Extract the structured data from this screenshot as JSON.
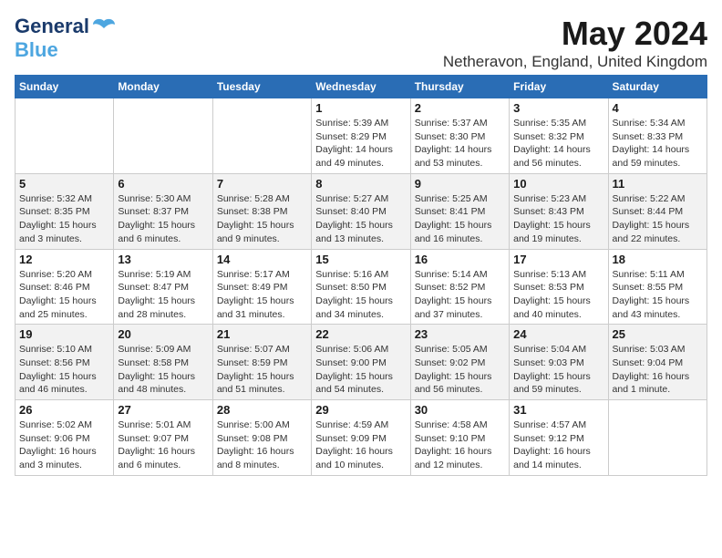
{
  "header": {
    "logo_line1": "General",
    "logo_line2": "Blue",
    "title": "May 2024",
    "subtitle": "Netheravon, England, United Kingdom"
  },
  "weekdays": [
    "Sunday",
    "Monday",
    "Tuesday",
    "Wednesday",
    "Thursday",
    "Friday",
    "Saturday"
  ],
  "weeks": [
    [
      {
        "day": "",
        "info": ""
      },
      {
        "day": "",
        "info": ""
      },
      {
        "day": "",
        "info": ""
      },
      {
        "day": "1",
        "info": "Sunrise: 5:39 AM\nSunset: 8:29 PM\nDaylight: 14 hours\nand 49 minutes."
      },
      {
        "day": "2",
        "info": "Sunrise: 5:37 AM\nSunset: 8:30 PM\nDaylight: 14 hours\nand 53 minutes."
      },
      {
        "day": "3",
        "info": "Sunrise: 5:35 AM\nSunset: 8:32 PM\nDaylight: 14 hours\nand 56 minutes."
      },
      {
        "day": "4",
        "info": "Sunrise: 5:34 AM\nSunset: 8:33 PM\nDaylight: 14 hours\nand 59 minutes."
      }
    ],
    [
      {
        "day": "5",
        "info": "Sunrise: 5:32 AM\nSunset: 8:35 PM\nDaylight: 15 hours\nand 3 minutes."
      },
      {
        "day": "6",
        "info": "Sunrise: 5:30 AM\nSunset: 8:37 PM\nDaylight: 15 hours\nand 6 minutes."
      },
      {
        "day": "7",
        "info": "Sunrise: 5:28 AM\nSunset: 8:38 PM\nDaylight: 15 hours\nand 9 minutes."
      },
      {
        "day": "8",
        "info": "Sunrise: 5:27 AM\nSunset: 8:40 PM\nDaylight: 15 hours\nand 13 minutes."
      },
      {
        "day": "9",
        "info": "Sunrise: 5:25 AM\nSunset: 8:41 PM\nDaylight: 15 hours\nand 16 minutes."
      },
      {
        "day": "10",
        "info": "Sunrise: 5:23 AM\nSunset: 8:43 PM\nDaylight: 15 hours\nand 19 minutes."
      },
      {
        "day": "11",
        "info": "Sunrise: 5:22 AM\nSunset: 8:44 PM\nDaylight: 15 hours\nand 22 minutes."
      }
    ],
    [
      {
        "day": "12",
        "info": "Sunrise: 5:20 AM\nSunset: 8:46 PM\nDaylight: 15 hours\nand 25 minutes."
      },
      {
        "day": "13",
        "info": "Sunrise: 5:19 AM\nSunset: 8:47 PM\nDaylight: 15 hours\nand 28 minutes."
      },
      {
        "day": "14",
        "info": "Sunrise: 5:17 AM\nSunset: 8:49 PM\nDaylight: 15 hours\nand 31 minutes."
      },
      {
        "day": "15",
        "info": "Sunrise: 5:16 AM\nSunset: 8:50 PM\nDaylight: 15 hours\nand 34 minutes."
      },
      {
        "day": "16",
        "info": "Sunrise: 5:14 AM\nSunset: 8:52 PM\nDaylight: 15 hours\nand 37 minutes."
      },
      {
        "day": "17",
        "info": "Sunrise: 5:13 AM\nSunset: 8:53 PM\nDaylight: 15 hours\nand 40 minutes."
      },
      {
        "day": "18",
        "info": "Sunrise: 5:11 AM\nSunset: 8:55 PM\nDaylight: 15 hours\nand 43 minutes."
      }
    ],
    [
      {
        "day": "19",
        "info": "Sunrise: 5:10 AM\nSunset: 8:56 PM\nDaylight: 15 hours\nand 46 minutes."
      },
      {
        "day": "20",
        "info": "Sunrise: 5:09 AM\nSunset: 8:58 PM\nDaylight: 15 hours\nand 48 minutes."
      },
      {
        "day": "21",
        "info": "Sunrise: 5:07 AM\nSunset: 8:59 PM\nDaylight: 15 hours\nand 51 minutes."
      },
      {
        "day": "22",
        "info": "Sunrise: 5:06 AM\nSunset: 9:00 PM\nDaylight: 15 hours\nand 54 minutes."
      },
      {
        "day": "23",
        "info": "Sunrise: 5:05 AM\nSunset: 9:02 PM\nDaylight: 15 hours\nand 56 minutes."
      },
      {
        "day": "24",
        "info": "Sunrise: 5:04 AM\nSunset: 9:03 PM\nDaylight: 15 hours\nand 59 minutes."
      },
      {
        "day": "25",
        "info": "Sunrise: 5:03 AM\nSunset: 9:04 PM\nDaylight: 16 hours\nand 1 minute."
      }
    ],
    [
      {
        "day": "26",
        "info": "Sunrise: 5:02 AM\nSunset: 9:06 PM\nDaylight: 16 hours\nand 3 minutes."
      },
      {
        "day": "27",
        "info": "Sunrise: 5:01 AM\nSunset: 9:07 PM\nDaylight: 16 hours\nand 6 minutes."
      },
      {
        "day": "28",
        "info": "Sunrise: 5:00 AM\nSunset: 9:08 PM\nDaylight: 16 hours\nand 8 minutes."
      },
      {
        "day": "29",
        "info": "Sunrise: 4:59 AM\nSunset: 9:09 PM\nDaylight: 16 hours\nand 10 minutes."
      },
      {
        "day": "30",
        "info": "Sunrise: 4:58 AM\nSunset: 9:10 PM\nDaylight: 16 hours\nand 12 minutes."
      },
      {
        "day": "31",
        "info": "Sunrise: 4:57 AM\nSunset: 9:12 PM\nDaylight: 16 hours\nand 14 minutes."
      },
      {
        "day": "",
        "info": ""
      }
    ]
  ]
}
